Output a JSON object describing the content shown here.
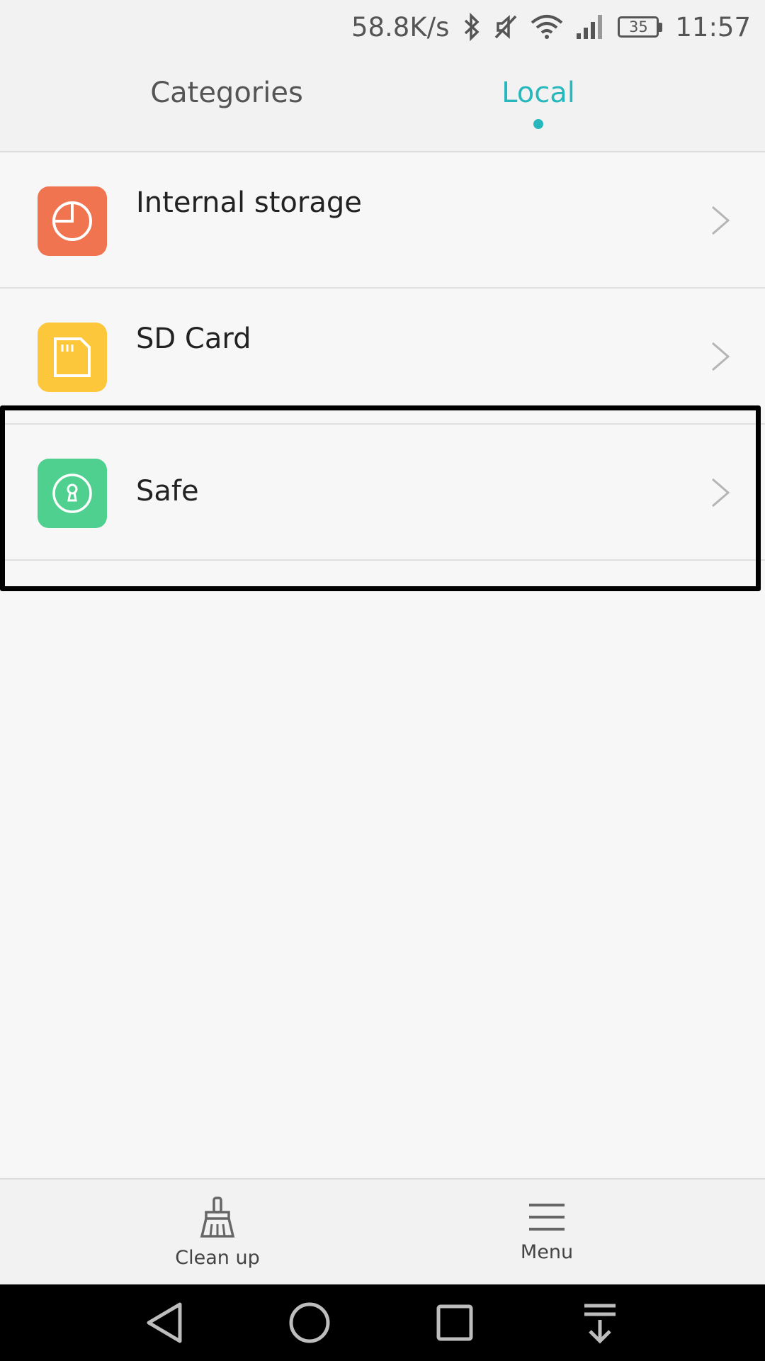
{
  "status_bar": {
    "speed": "58.8K/s",
    "battery": "35",
    "time": "11:57",
    "icons": [
      "bluetooth-icon",
      "mute-icon",
      "wifi-icon",
      "signal-icon",
      "battery-icon"
    ]
  },
  "tabs": [
    {
      "label": "Categories",
      "active": false
    },
    {
      "label": "Local",
      "active": true
    }
  ],
  "list": [
    {
      "label": "Internal storage",
      "icon": "storage-pie-icon",
      "icon_color": "#f07450"
    },
    {
      "label": "SD Card",
      "icon": "sd-card-icon",
      "icon_color": "#fcc73a"
    },
    {
      "label": "Safe",
      "icon": "safe-lock-icon",
      "icon_color": "#4fd08e"
    }
  ],
  "bottom_bar": {
    "cleanup_label": "Clean up",
    "menu_label": "Menu"
  },
  "colors": {
    "accent": "#27b8bd",
    "highlight": "#000000"
  }
}
